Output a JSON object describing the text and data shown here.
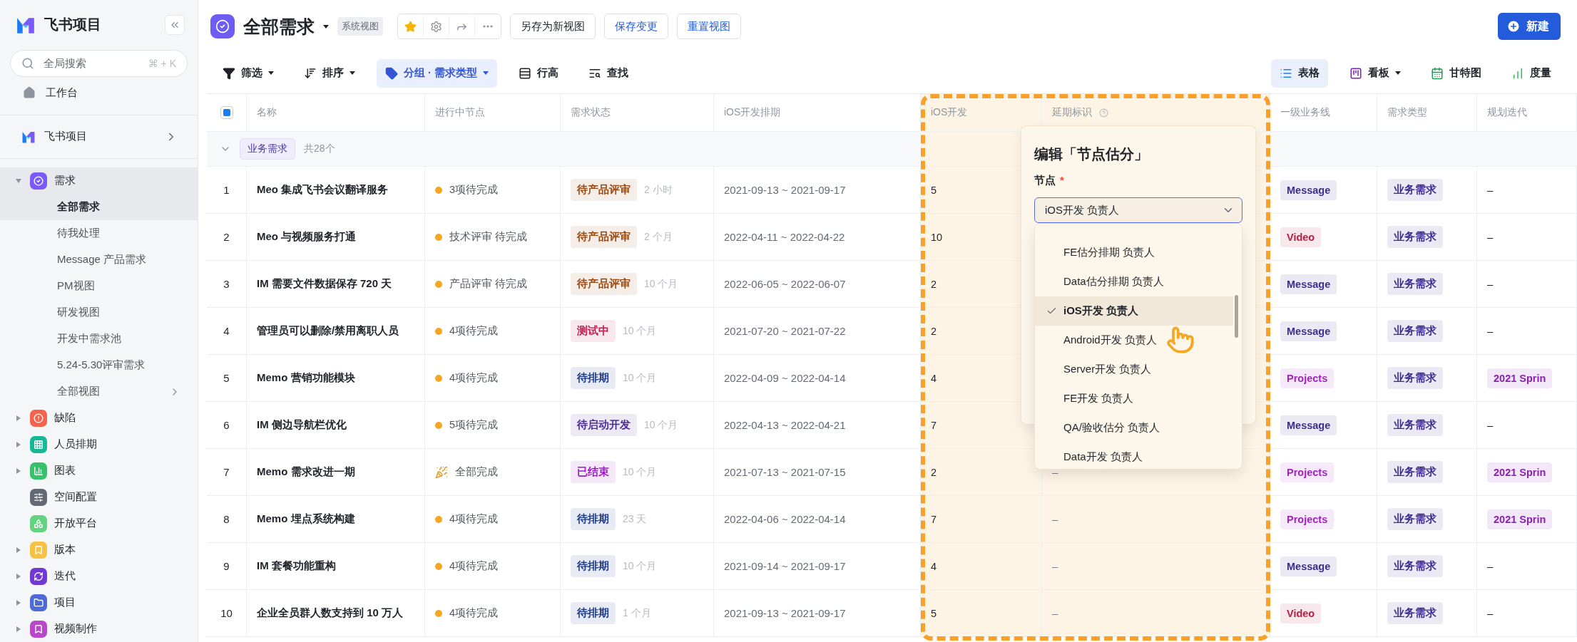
{
  "sidebar": {
    "brand": "飞书项目",
    "search": {
      "placeholder": "全局搜索",
      "shortcut": "⌘ + K"
    },
    "home": "工作台",
    "space": "飞书项目",
    "nav": [
      {
        "label": "需求",
        "color": "#7a5af8",
        "kind": "group",
        "expanded": true,
        "children": [
          {
            "label": "全部需求",
            "selected": true,
            "kind": "view"
          },
          {
            "label": "待我处理",
            "selected": false,
            "kind": "view"
          },
          {
            "label": "Message 产品需求",
            "selected": false,
            "kind": "view"
          },
          {
            "label": "PM视图",
            "selected": false,
            "kind": "view"
          },
          {
            "label": "研发视图",
            "selected": false,
            "kind": "view"
          },
          {
            "label": "开发中需求池",
            "selected": false,
            "kind": "view"
          },
          {
            "label": "5.24-5.30评审需求",
            "selected": false,
            "kind": "view"
          },
          {
            "label": "全部视图",
            "selected": false,
            "kind": "more"
          }
        ]
      },
      {
        "label": "缺陷",
        "color": "#f5624d",
        "kind": "group",
        "expanded": false
      },
      {
        "label": "人员排期",
        "color": "#17b897",
        "kind": "group",
        "expanded": false
      },
      {
        "label": "图表",
        "color": "#34c26b",
        "kind": "group",
        "expanded": false
      },
      {
        "label": "空间配置",
        "color": "#646a73",
        "kind": "link"
      },
      {
        "label": "开放平台",
        "color": "#63d37f",
        "kind": "link"
      },
      {
        "label": "版本",
        "color": "#f7c244",
        "kind": "group",
        "expanded": false
      },
      {
        "label": "迭代",
        "color": "#7238d6",
        "kind": "group",
        "expanded": false
      },
      {
        "label": "项目",
        "color": "#4e6ad6",
        "kind": "group",
        "expanded": false
      },
      {
        "label": "视频制作",
        "color": "#b848c9",
        "kind": "group",
        "expanded": false
      }
    ]
  },
  "header": {
    "title": "全部需求",
    "badge": "系统视图",
    "starred": true,
    "buttons": [
      {
        "label": "另存为新视图",
        "kind": "default"
      },
      {
        "label": "保存变更",
        "kind": "link"
      },
      {
        "label": "重置视图",
        "kind": "link"
      }
    ],
    "create": "新建"
  },
  "toolbar": {
    "tools": [
      {
        "label": "筛选",
        "kind": "filter",
        "dropdown": true,
        "selected": false
      },
      {
        "label": "排序",
        "kind": "sort",
        "dropdown": true,
        "selected": false
      },
      {
        "label": "分组 · 需求类型",
        "kind": "group",
        "dropdown": true,
        "selected": true
      },
      {
        "label": "行高",
        "kind": "height",
        "dropdown": false,
        "selected": false
      },
      {
        "label": "查找",
        "kind": "find",
        "dropdown": false,
        "selected": false
      }
    ],
    "views": [
      {
        "label": "表格",
        "kind": "table",
        "dropdown": false,
        "selected": true
      },
      {
        "label": "看板",
        "kind": "board",
        "dropdown": true,
        "selected": false
      },
      {
        "label": "甘特图",
        "kind": "gantt",
        "dropdown": false,
        "selected": false
      },
      {
        "label": "度量",
        "kind": "metrics",
        "dropdown": false,
        "selected": false
      }
    ]
  },
  "table": {
    "indeterminate": true,
    "columns": [
      {
        "label": "名称",
        "highlighted": false
      },
      {
        "label": "进行中节点",
        "highlighted": false
      },
      {
        "label": "需求状态",
        "highlighted": false
      },
      {
        "label": "iOS开发排期",
        "highlighted": false
      },
      {
        "label": "iOS开发",
        "highlighted": true
      },
      {
        "label": "延期标识",
        "highlighted": true,
        "help": true
      },
      {
        "label": "一级业务线",
        "highlighted": false
      },
      {
        "label": "需求类型",
        "highlighted": false
      },
      {
        "label": "规划迭代",
        "highlighted": false
      }
    ],
    "group": {
      "label": "业务需求",
      "count": "共28个",
      "expanded": true
    },
    "rows": [
      {
        "index": "1",
        "name": "Meo 集成飞书会议翻译服务",
        "node": {
          "kind": "pending",
          "text": "3项待完成"
        },
        "status": {
          "label": "待产品评审",
          "color": "#9a4a12"
        },
        "age": "2 小时",
        "schedule": "2021-09-13 ~ 2021-09-17",
        "ios": "5",
        "line": {
          "label": "Message",
          "color": "#3f2d8f"
        },
        "type": "业务需求",
        "iteration": {
          "kind": "empty",
          "label": "–"
        }
      },
      {
        "index": "2",
        "name": "Meo 与视频服务打通",
        "node": {
          "kind": "pending",
          "text": "技术评审 待完成"
        },
        "status": {
          "label": "待产品评审",
          "color": "#9a4a12"
        },
        "age": "2 个月",
        "schedule": "2022-04-11 ~ 2022-04-22",
        "ios": "10",
        "line": {
          "label": "Video",
          "color": "#b81e45"
        },
        "type": "业务需求",
        "iteration": {
          "kind": "empty",
          "label": "–"
        }
      },
      {
        "index": "3",
        "name": "IM 需要文件数据保存 720 天",
        "node": {
          "kind": "pending",
          "text": "产品评审 待完成"
        },
        "status": {
          "label": "待产品评审",
          "color": "#9a4a12"
        },
        "age": "10 个月",
        "schedule": "2022-06-05 ~ 2022-06-07",
        "ios": "2",
        "line": {
          "label": "Message",
          "color": "#3f2d8f"
        },
        "type": "业务需求",
        "iteration": {
          "kind": "empty",
          "label": "–"
        }
      },
      {
        "index": "4",
        "name": "管理员可以删除/禁用离职人员",
        "node": {
          "kind": "pending",
          "text": "4项待完成"
        },
        "status": {
          "label": "测试中",
          "color": "#c41d4f"
        },
        "age": "10 个月",
        "schedule": "2021-07-20 ~ 2021-07-22",
        "ios": "2",
        "line": {
          "label": "Message",
          "color": "#3f2d8f"
        },
        "type": "业务需求",
        "iteration": {
          "kind": "empty",
          "label": "–"
        }
      },
      {
        "index": "5",
        "name": "Memo 营销功能模块",
        "node": {
          "kind": "pending",
          "text": "4项待完成"
        },
        "status": {
          "label": "待排期",
          "color": "#1e3a8a"
        },
        "age": "10 个月",
        "schedule": "2022-04-09 ~ 2022-04-14",
        "ios": "4",
        "line": {
          "label": "Projects",
          "color": "#a323c2"
        },
        "type": "业务需求",
        "iteration": {
          "kind": "tag",
          "label": "2021 Sprin"
        }
      },
      {
        "index": "6",
        "name": "IM 侧边导航栏优化",
        "node": {
          "kind": "pending",
          "text": "5项待完成"
        },
        "status": {
          "label": "待启动开发",
          "color": "#4c2a9e"
        },
        "age": "10 个月",
        "schedule": "2022-04-13 ~ 2022-04-21",
        "ios": "7",
        "line": {
          "label": "Message",
          "color": "#3f2d8f"
        },
        "type": "业务需求",
        "iteration": {
          "kind": "empty",
          "label": "–"
        }
      },
      {
        "index": "7",
        "name": "Memo 需求改进一期",
        "node": {
          "kind": "done",
          "text": "全部完成"
        },
        "status": {
          "label": "已结束",
          "color": "#9b1fc0"
        },
        "age": "10 个月",
        "schedule": "2021-07-13 ~ 2021-07-15",
        "ios": "2",
        "delay": "–",
        "line": {
          "label": "Projects",
          "color": "#a323c2"
        },
        "type": "业务需求",
        "iteration": {
          "kind": "tag",
          "label": "2021 Sprin"
        }
      },
      {
        "index": "8",
        "name": "Memo 埋点系统构建",
        "node": {
          "kind": "pending",
          "text": "4项待完成"
        },
        "status": {
          "label": "待排期",
          "color": "#1e3a8a"
        },
        "age": "23 天",
        "schedule": "2022-04-06 ~ 2022-04-14",
        "ios": "7",
        "delay": "–",
        "line": {
          "label": "Projects",
          "color": "#a323c2"
        },
        "type": "业务需求",
        "iteration": {
          "kind": "tag",
          "label": "2021 Sprin"
        }
      },
      {
        "index": "9",
        "name": "IM 套餐功能重构",
        "node": {
          "kind": "pending",
          "text": "4项待完成"
        },
        "status": {
          "label": "待排期",
          "color": "#1e3a8a"
        },
        "age": "10 个月",
        "schedule": "2021-09-14 ~ 2021-09-17",
        "ios": "4",
        "delay": "–",
        "line": {
          "label": "Message",
          "color": "#3f2d8f"
        },
        "type": "业务需求",
        "iteration": {
          "kind": "empty",
          "label": "–"
        }
      },
      {
        "index": "10",
        "name": "企业全员群人数支持到 10 万人",
        "node": {
          "kind": "pending",
          "text": "4项待完成"
        },
        "status": {
          "label": "待排期",
          "color": "#1e3a8a"
        },
        "age": "1 个月",
        "schedule": "2021-09-13 ~ 2021-09-17",
        "ios": "5",
        "delay": "–",
        "line": {
          "label": "Video",
          "color": "#b81e45"
        },
        "type": "业务需求",
        "iteration": {
          "kind": "empty",
          "label": "–"
        }
      }
    ]
  },
  "popup": {
    "title": "编辑「节点估分」",
    "label": "节点",
    "required_mark": "*",
    "value": "iOS开发 负责人",
    "options": [
      {
        "label": "FE估分排期 负责人",
        "selected": false
      },
      {
        "label": "Data估分排期 负责人",
        "selected": false
      },
      {
        "label": "iOS开发 负责人",
        "selected": true
      },
      {
        "label": "Android开发 负责人",
        "selected": false
      },
      {
        "label": "Server开发 负责人",
        "selected": false
      },
      {
        "label": "FE开发 负责人",
        "selected": false
      },
      {
        "label": "QA/验收估分 负责人",
        "selected": false
      },
      {
        "label": "Data开发 负责人",
        "selected": false
      }
    ]
  }
}
